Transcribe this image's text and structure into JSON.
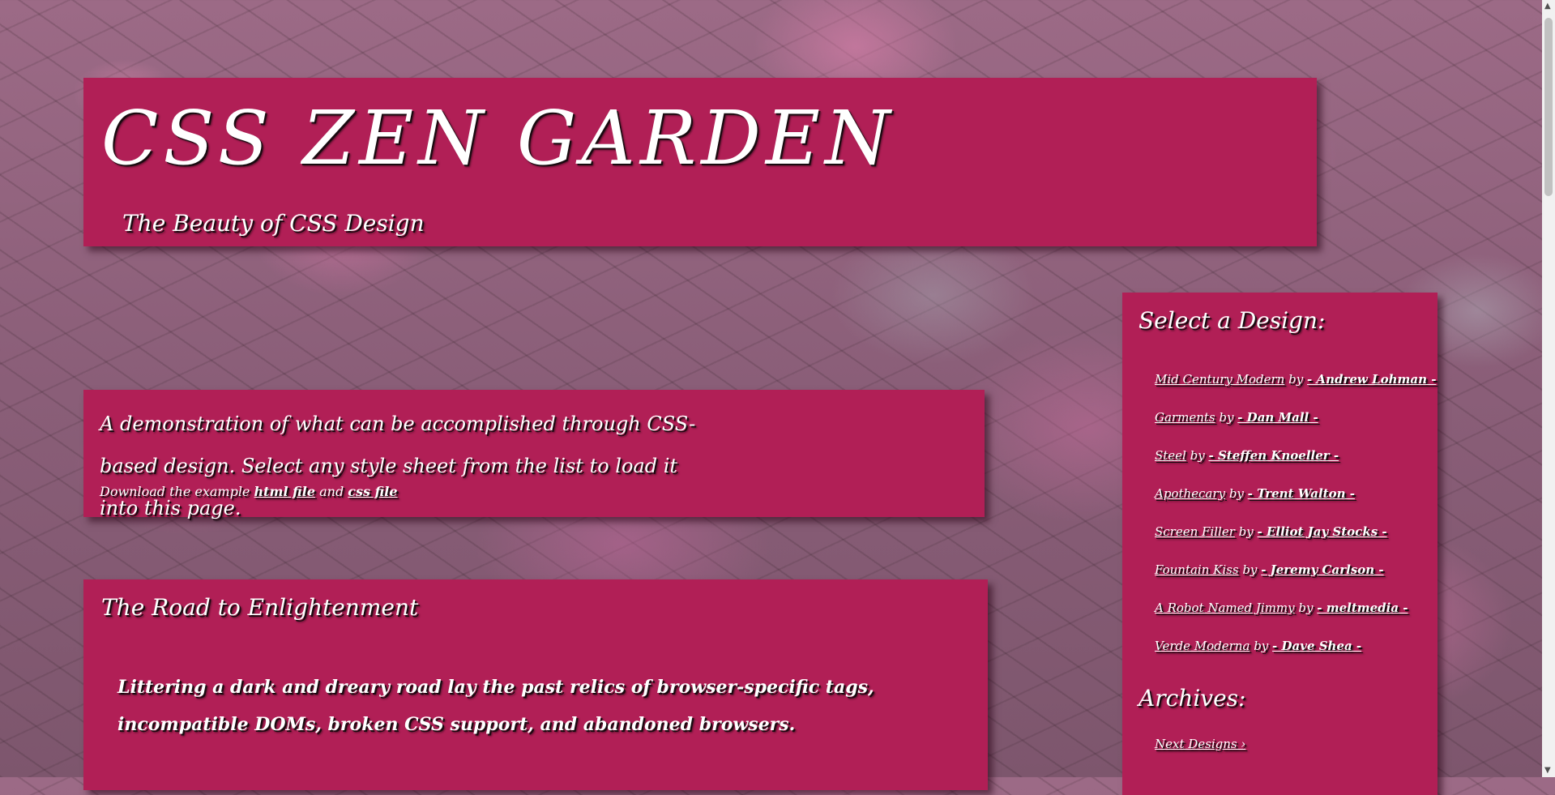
{
  "header": {
    "title": "CSS ZEN GARDEN",
    "tagline": "The Beauty of CSS Design"
  },
  "intro": {
    "summary": "A demonstration of what can be accomplished through CSS-based design. Select any style sheet from the list to load it into this page.",
    "download_prefix": "Download the example",
    "html_link": "html file",
    "and_text": "and",
    "css_link": "css file"
  },
  "road": {
    "title": "The Road to Enlightenment",
    "text": "Littering a dark and dreary road lay the past relics of browser-specific tags, incompatible DOMs, broken CSS support, and abandoned browsers."
  },
  "sidebar": {
    "select_heading": "Select a Design:",
    "by": "by",
    "designs": [
      {
        "name": "Mid Century Modern",
        "author": "- Andrew Lohman -"
      },
      {
        "name": "Garments",
        "author": "- Dan Mall -"
      },
      {
        "name": "Steel",
        "author": "- Steffen Knoeller -"
      },
      {
        "name": "Apothecary",
        "author": "- Trent Walton -"
      },
      {
        "name": "Screen Filler",
        "author": "- Elliot Jay Stocks -"
      },
      {
        "name": "Fountain Kiss",
        "author": "- Jeremy Carlson -"
      },
      {
        "name": "A Robot Named Jimmy",
        "author": "- meltmedia -"
      },
      {
        "name": "Verde Moderna",
        "author": "- Dave Shea -"
      }
    ],
    "archives_heading": "Archives:",
    "next_designs": "Next Designs ›"
  },
  "colors": {
    "panel": "#b11f56",
    "text": "#ffffff"
  }
}
